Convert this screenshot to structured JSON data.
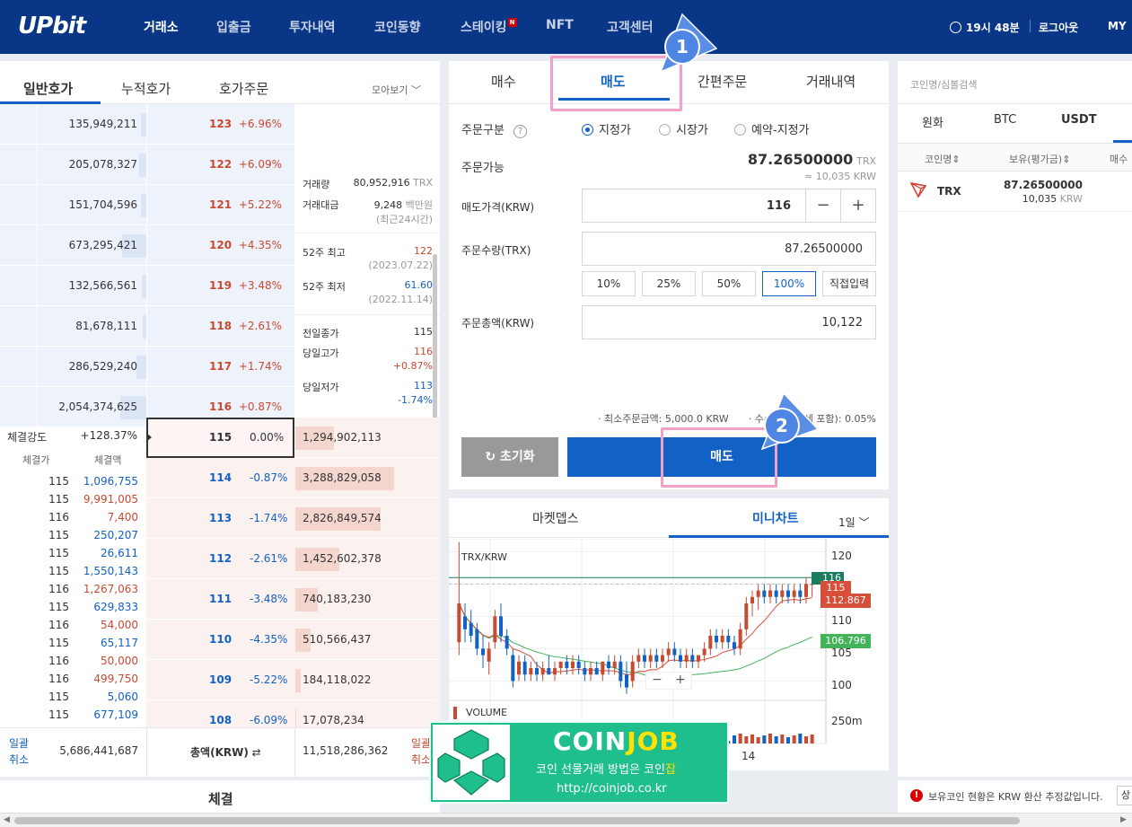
{
  "nav": {
    "logo": "UPbit",
    "items": [
      "거래소",
      "입출금",
      "투자내역",
      "코인동향",
      "스테이킹",
      "NFT",
      "고객센터"
    ],
    "new_badge": "N",
    "time": "19시 48분",
    "logout": "로그아웃",
    "my": "MY"
  },
  "orderbook": {
    "tabs": [
      "일반호가",
      "누적호가",
      "호가주문"
    ],
    "view": "모아보기",
    "asks": [
      {
        "qty": "135,949,211",
        "price": "123",
        "change": "+6.96%",
        "fill": 0.05
      },
      {
        "qty": "205,078,327",
        "price": "122",
        "change": "+6.09%",
        "fill": 0.07
      },
      {
        "qty": "151,704,596",
        "price": "121",
        "change": "+5.22%",
        "fill": 0.05
      },
      {
        "qty": "673,295,421",
        "price": "120",
        "change": "+4.35%",
        "fill": 0.22
      },
      {
        "qty": "132,566,561",
        "price": "119",
        "change": "+3.48%",
        "fill": 0.04
      },
      {
        "qty": "81,678,111",
        "price": "118",
        "change": "+2.61%",
        "fill": 0.03
      },
      {
        "qty": "286,529,240",
        "price": "117",
        "change": "+1.74%",
        "fill": 0.09
      },
      {
        "qty": "2,054,374,625",
        "price": "116",
        "change": "+0.87%",
        "fill": 0.24
      }
    ],
    "bids": [
      {
        "price": "115",
        "change": "0.00%",
        "qty": "1,294,902,113",
        "fill": 0.36
      },
      {
        "price": "114",
        "change": "-0.87%",
        "qty": "3,288,829,058",
        "fill": 0.92
      },
      {
        "price": "113",
        "change": "-1.74%",
        "qty": "2,826,849,574",
        "fill": 0.79
      },
      {
        "price": "112",
        "change": "-2.61%",
        "qty": "1,452,602,378",
        "fill": 0.41
      },
      {
        "price": "111",
        "change": "-3.48%",
        "qty": "740,183,230",
        "fill": 0.21
      },
      {
        "price": "110",
        "change": "-4.35%",
        "qty": "510,566,437",
        "fill": 0.14
      },
      {
        "price": "109",
        "change": "-5.22%",
        "qty": "184,118,022",
        "fill": 0.05
      },
      {
        "price": "108",
        "change": "-6.09%",
        "qty": "17,078,234",
        "fill": 0.01
      }
    ],
    "info": {
      "volume_label": "거래량",
      "volume": "80,952,916",
      "volume_unit": "TRX",
      "amount_label": "거래대금",
      "amount": "9,248",
      "amount_unit": "백만원",
      "amount_note": "(최근24시간)",
      "high52_label": "52주 최고",
      "high52": "122",
      "high52_date": "(2023.07.22)",
      "low52_label": "52주 최저",
      "low52": "61.60",
      "low52_date": "(2022.11.14)",
      "prev_close_label": "전일종가",
      "prev_close": "115",
      "day_high_label": "당일고가",
      "day_high": "116",
      "day_high_pct": "+0.87%",
      "day_low_label": "당일저가",
      "day_low": "113",
      "day_low_pct": "-1.74%"
    },
    "strength_label": "체결강도",
    "strength": "+128.37%",
    "trade_headers": [
      "체결가",
      "체결액"
    ],
    "trades": [
      {
        "price": "115",
        "amount": "1,096,755",
        "side": "buy"
      },
      {
        "price": "115",
        "amount": "9,991,005",
        "side": "sell"
      },
      {
        "price": "116",
        "amount": "7,400",
        "side": "sell"
      },
      {
        "price": "115",
        "amount": "250,207",
        "side": "buy"
      },
      {
        "price": "115",
        "amount": "26,611",
        "side": "buy"
      },
      {
        "price": "115",
        "amount": "1,550,143",
        "side": "buy"
      },
      {
        "price": "116",
        "amount": "1,267,063",
        "side": "sell"
      },
      {
        "price": "115",
        "amount": "629,833",
        "side": "buy"
      },
      {
        "price": "116",
        "amount": "54,000",
        "side": "sell"
      },
      {
        "price": "115",
        "amount": "65,117",
        "side": "buy"
      },
      {
        "price": "116",
        "amount": "50,000",
        "side": "sell"
      },
      {
        "price": "116",
        "amount": "499,750",
        "side": "sell"
      },
      {
        "price": "115",
        "amount": "5,060",
        "side": "buy"
      },
      {
        "price": "115",
        "amount": "677,109",
        "side": "buy"
      }
    ],
    "footer": {
      "bulk_cancel_l1": "일괄",
      "bulk_cancel_l2": "취소",
      "ask_total": "5,686,441,687",
      "total_label": "총액(KRW)",
      "bid_total": "11,518,286,362"
    },
    "bottom_label": "체결"
  },
  "order": {
    "tabs": [
      "매수",
      "매도",
      "간편주문",
      "거래내역"
    ],
    "type_label": "주문구분",
    "types": [
      "지정가",
      "시장가",
      "예약-지정가"
    ],
    "avail_label": "주문가능",
    "avail": "87.26500000",
    "avail_unit": "TRX",
    "avail_krw": "≈ 10,035 KRW",
    "price_label": "매도가격(KRW)",
    "price": "116",
    "qty_label": "주문수량(TRX)",
    "qty": "87.26500000",
    "pcts": [
      "10%",
      "25%",
      "50%",
      "100%",
      "직접입력"
    ],
    "total_label": "주문총액(KRW)",
    "total": "10,122",
    "min_note": "· 최소주문금액: 5,000.0 KRW",
    "fee_note": "· 수수료(부가세 포함): 0.05%",
    "reset": "초기화",
    "submit": "매도"
  },
  "chart": {
    "tabs": [
      "마켓뎁스",
      "미니차트"
    ],
    "period": "1일",
    "pair": "TRX/KRW",
    "volume_label": "VOLUME",
    "current": "115",
    "ma1": "112.867",
    "ma2": "106.796",
    "top_tag": "116",
    "x_tick": "14",
    "vol_tick": "250m",
    "yticks": [
      "120",
      "115",
      "110",
      "105",
      "100"
    ],
    "zoom_minus": "−",
    "zoom_plus": "+"
  },
  "chart_data": {
    "type": "candlestick",
    "title": "TRX/KRW",
    "period": "1일",
    "ylim": [
      97,
      122
    ],
    "candles": [
      {
        "o": 106,
        "h": 121.5,
        "l": 104,
        "c": 112
      },
      {
        "o": 110,
        "h": 112,
        "l": 106,
        "c": 108
      },
      {
        "o": 109,
        "h": 111,
        "l": 106,
        "c": 107
      },
      {
        "o": 108,
        "h": 109,
        "l": 104,
        "c": 105
      },
      {
        "o": 105,
        "h": 107,
        "l": 102,
        "c": 104
      },
      {
        "o": 103,
        "h": 106,
        "l": 101,
        "c": 105
      },
      {
        "o": 106,
        "h": 111,
        "l": 105,
        "c": 110
      },
      {
        "o": 110,
        "h": 112,
        "l": 106,
        "c": 107
      },
      {
        "o": 107,
        "h": 108,
        "l": 104,
        "c": 105
      },
      {
        "o": 104,
        "h": 105,
        "l": 99,
        "c": 100
      },
      {
        "o": 101,
        "h": 104,
        "l": 100,
        "c": 103
      },
      {
        "o": 103,
        "h": 104,
        "l": 100,
        "c": 101
      },
      {
        "o": 101,
        "h": 103,
        "l": 100,
        "c": 102
      },
      {
        "o": 102,
        "h": 103,
        "l": 100,
        "c": 101
      },
      {
        "o": 101,
        "h": 103,
        "l": 100,
        "c": 102
      },
      {
        "o": 102,
        "h": 104,
        "l": 101,
        "c": 101
      },
      {
        "o": 101,
        "h": 103,
        "l": 100,
        "c": 102
      },
      {
        "o": 102,
        "h": 103,
        "l": 101,
        "c": 103
      },
      {
        "o": 103,
        "h": 104,
        "l": 101,
        "c": 102
      },
      {
        "o": 102,
        "h": 104,
        "l": 101,
        "c": 103
      },
      {
        "o": 103,
        "h": 104,
        "l": 101,
        "c": 102
      },
      {
        "o": 102,
        "h": 103,
        "l": 100,
        "c": 101
      },
      {
        "o": 101,
        "h": 103,
        "l": 100,
        "c": 102
      },
      {
        "o": 102,
        "h": 103,
        "l": 101,
        "c": 101
      },
      {
        "o": 101,
        "h": 103,
        "l": 100,
        "c": 103
      },
      {
        "o": 103,
        "h": 104,
        "l": 101,
        "c": 102
      },
      {
        "o": 102,
        "h": 104,
        "l": 101,
        "c": 103
      },
      {
        "o": 103,
        "h": 104,
        "l": 99,
        "c": 100
      },
      {
        "o": 101,
        "h": 103,
        "l": 98,
        "c": 99
      },
      {
        "o": 100,
        "h": 104,
        "l": 99,
        "c": 103
      },
      {
        "o": 103,
        "h": 105,
        "l": 102,
        "c": 104
      },
      {
        "o": 104,
        "h": 105,
        "l": 102,
        "c": 103
      },
      {
        "o": 103,
        "h": 105,
        "l": 102,
        "c": 104
      },
      {
        "o": 104,
        "h": 105,
        "l": 102,
        "c": 103
      },
      {
        "o": 103,
        "h": 105,
        "l": 102,
        "c": 104
      },
      {
        "o": 104,
        "h": 106,
        "l": 103,
        "c": 105
      },
      {
        "o": 105,
        "h": 106,
        "l": 103,
        "c": 104
      },
      {
        "o": 104,
        "h": 105,
        "l": 102,
        "c": 103
      },
      {
        "o": 103,
        "h": 105,
        "l": 102,
        "c": 104
      },
      {
        "o": 104,
        "h": 105,
        "l": 102,
        "c": 103
      },
      {
        "o": 103,
        "h": 104,
        "l": 102,
        "c": 104
      },
      {
        "o": 104,
        "h": 106,
        "l": 103,
        "c": 105
      },
      {
        "o": 105,
        "h": 108,
        "l": 104,
        "c": 107
      },
      {
        "o": 107,
        "h": 108,
        "l": 105,
        "c": 106
      },
      {
        "o": 106,
        "h": 108,
        "l": 105,
        "c": 107
      },
      {
        "o": 107,
        "h": 108,
        "l": 105,
        "c": 106
      },
      {
        "o": 106,
        "h": 107,
        "l": 104,
        "c": 105
      },
      {
        "o": 105,
        "h": 109,
        "l": 104,
        "c": 108
      },
      {
        "o": 108,
        "h": 113,
        "l": 107,
        "c": 112
      },
      {
        "o": 112,
        "h": 114,
        "l": 110,
        "c": 113
      },
      {
        "o": 113,
        "h": 115,
        "l": 111,
        "c": 114
      },
      {
        "o": 114,
        "h": 115,
        "l": 112,
        "c": 113
      },
      {
        "o": 113,
        "h": 115,
        "l": 112,
        "c": 114
      },
      {
        "o": 114,
        "h": 115,
        "l": 112,
        "c": 113
      },
      {
        "o": 113,
        "h": 115,
        "l": 112,
        "c": 114
      },
      {
        "o": 114,
        "h": 115,
        "l": 112,
        "c": 113
      },
      {
        "o": 113,
        "h": 115,
        "l": 112,
        "c": 114
      },
      {
        "o": 114,
        "h": 115,
        "l": 112,
        "c": 113
      },
      {
        "o": 113,
        "h": 116,
        "l": 112,
        "c": 115
      },
      {
        "o": 115,
        "h": 116,
        "l": 113,
        "c": 115
      }
    ],
    "ma_short_end": 112.867,
    "ma_long_end": 106.796
  },
  "coinlist": {
    "search_placeholder": "코인명/심볼검색",
    "tabs": [
      "원화",
      "BTC",
      "USDT"
    ],
    "headers": [
      "코인명",
      "보유(평가금)",
      "매수"
    ],
    "rows": [
      {
        "name": "TRX",
        "qty": "87.26500000",
        "krw": "10,035",
        "unit": "KRW"
      }
    ],
    "notice": "보유코인 현황은 KRW 환산 추정값입니다.",
    "notice_btn": "상"
  },
  "annotations": {
    "one": "1",
    "two": "2"
  },
  "watermark": {
    "brand_a": "COIN",
    "brand_b": "JOB",
    "tagline_a": "코인 선물거래 방법은 코인",
    "tagline_b": "잡",
    "url": "http://coinjob.co.kr"
  },
  "colors": {
    "nav": "#093687",
    "ask": "#eef2fb",
    "bid": "#fbf1ef",
    "up": "#c84a31",
    "down": "#1261c4"
  }
}
